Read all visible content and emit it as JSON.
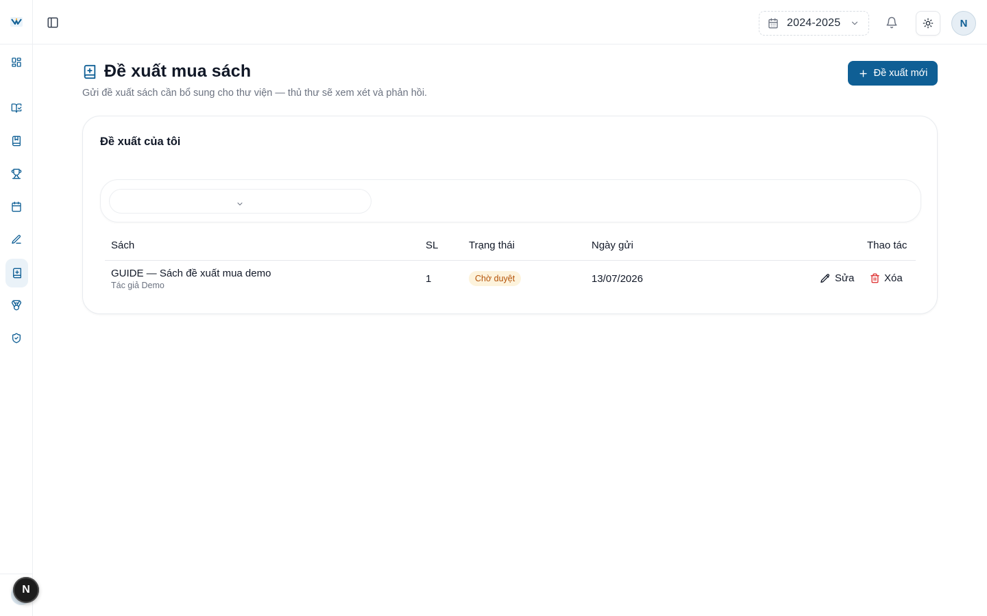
{
  "header": {
    "school_year": "2024-2025",
    "user_initial": "N"
  },
  "page": {
    "title": "Đề xuất mua sách",
    "subtitle": "Gửi đề xuất sách cần bổ sung cho thư viện — thủ thư sẽ xem xét và phản hồi.",
    "new_button_label": "Đề xuất mới"
  },
  "card": {
    "title": "Đề xuất của tôi",
    "filter_value": ""
  },
  "table": {
    "columns": [
      "Sách",
      "SL",
      "Trạng thái",
      "Ngày gửi",
      "Thao tác"
    ],
    "rows": [
      {
        "book_title": "GUIDE — Sách đề xuất mua demo",
        "author": "Tác giả Demo",
        "quantity": "1",
        "status": "Chờ duyệt",
        "date": "13/07/2026",
        "edit_label": "Sửa",
        "delete_label": "Xóa"
      }
    ]
  },
  "floating": {
    "initial": "N"
  },
  "colors": {
    "primary": "#0f5f95",
    "status_pending_bg": "#fdf3dc",
    "status_pending_text": "#b45309",
    "danger": "#dc2626"
  },
  "icons": {
    "sidebar": [
      "dashboard-icon",
      "book-open-check-icon",
      "book-icon",
      "trophy-icon",
      "calendar-icon",
      "pen-icon",
      "book-plus-icon",
      "medal-icon",
      "shield-check-icon"
    ]
  }
}
